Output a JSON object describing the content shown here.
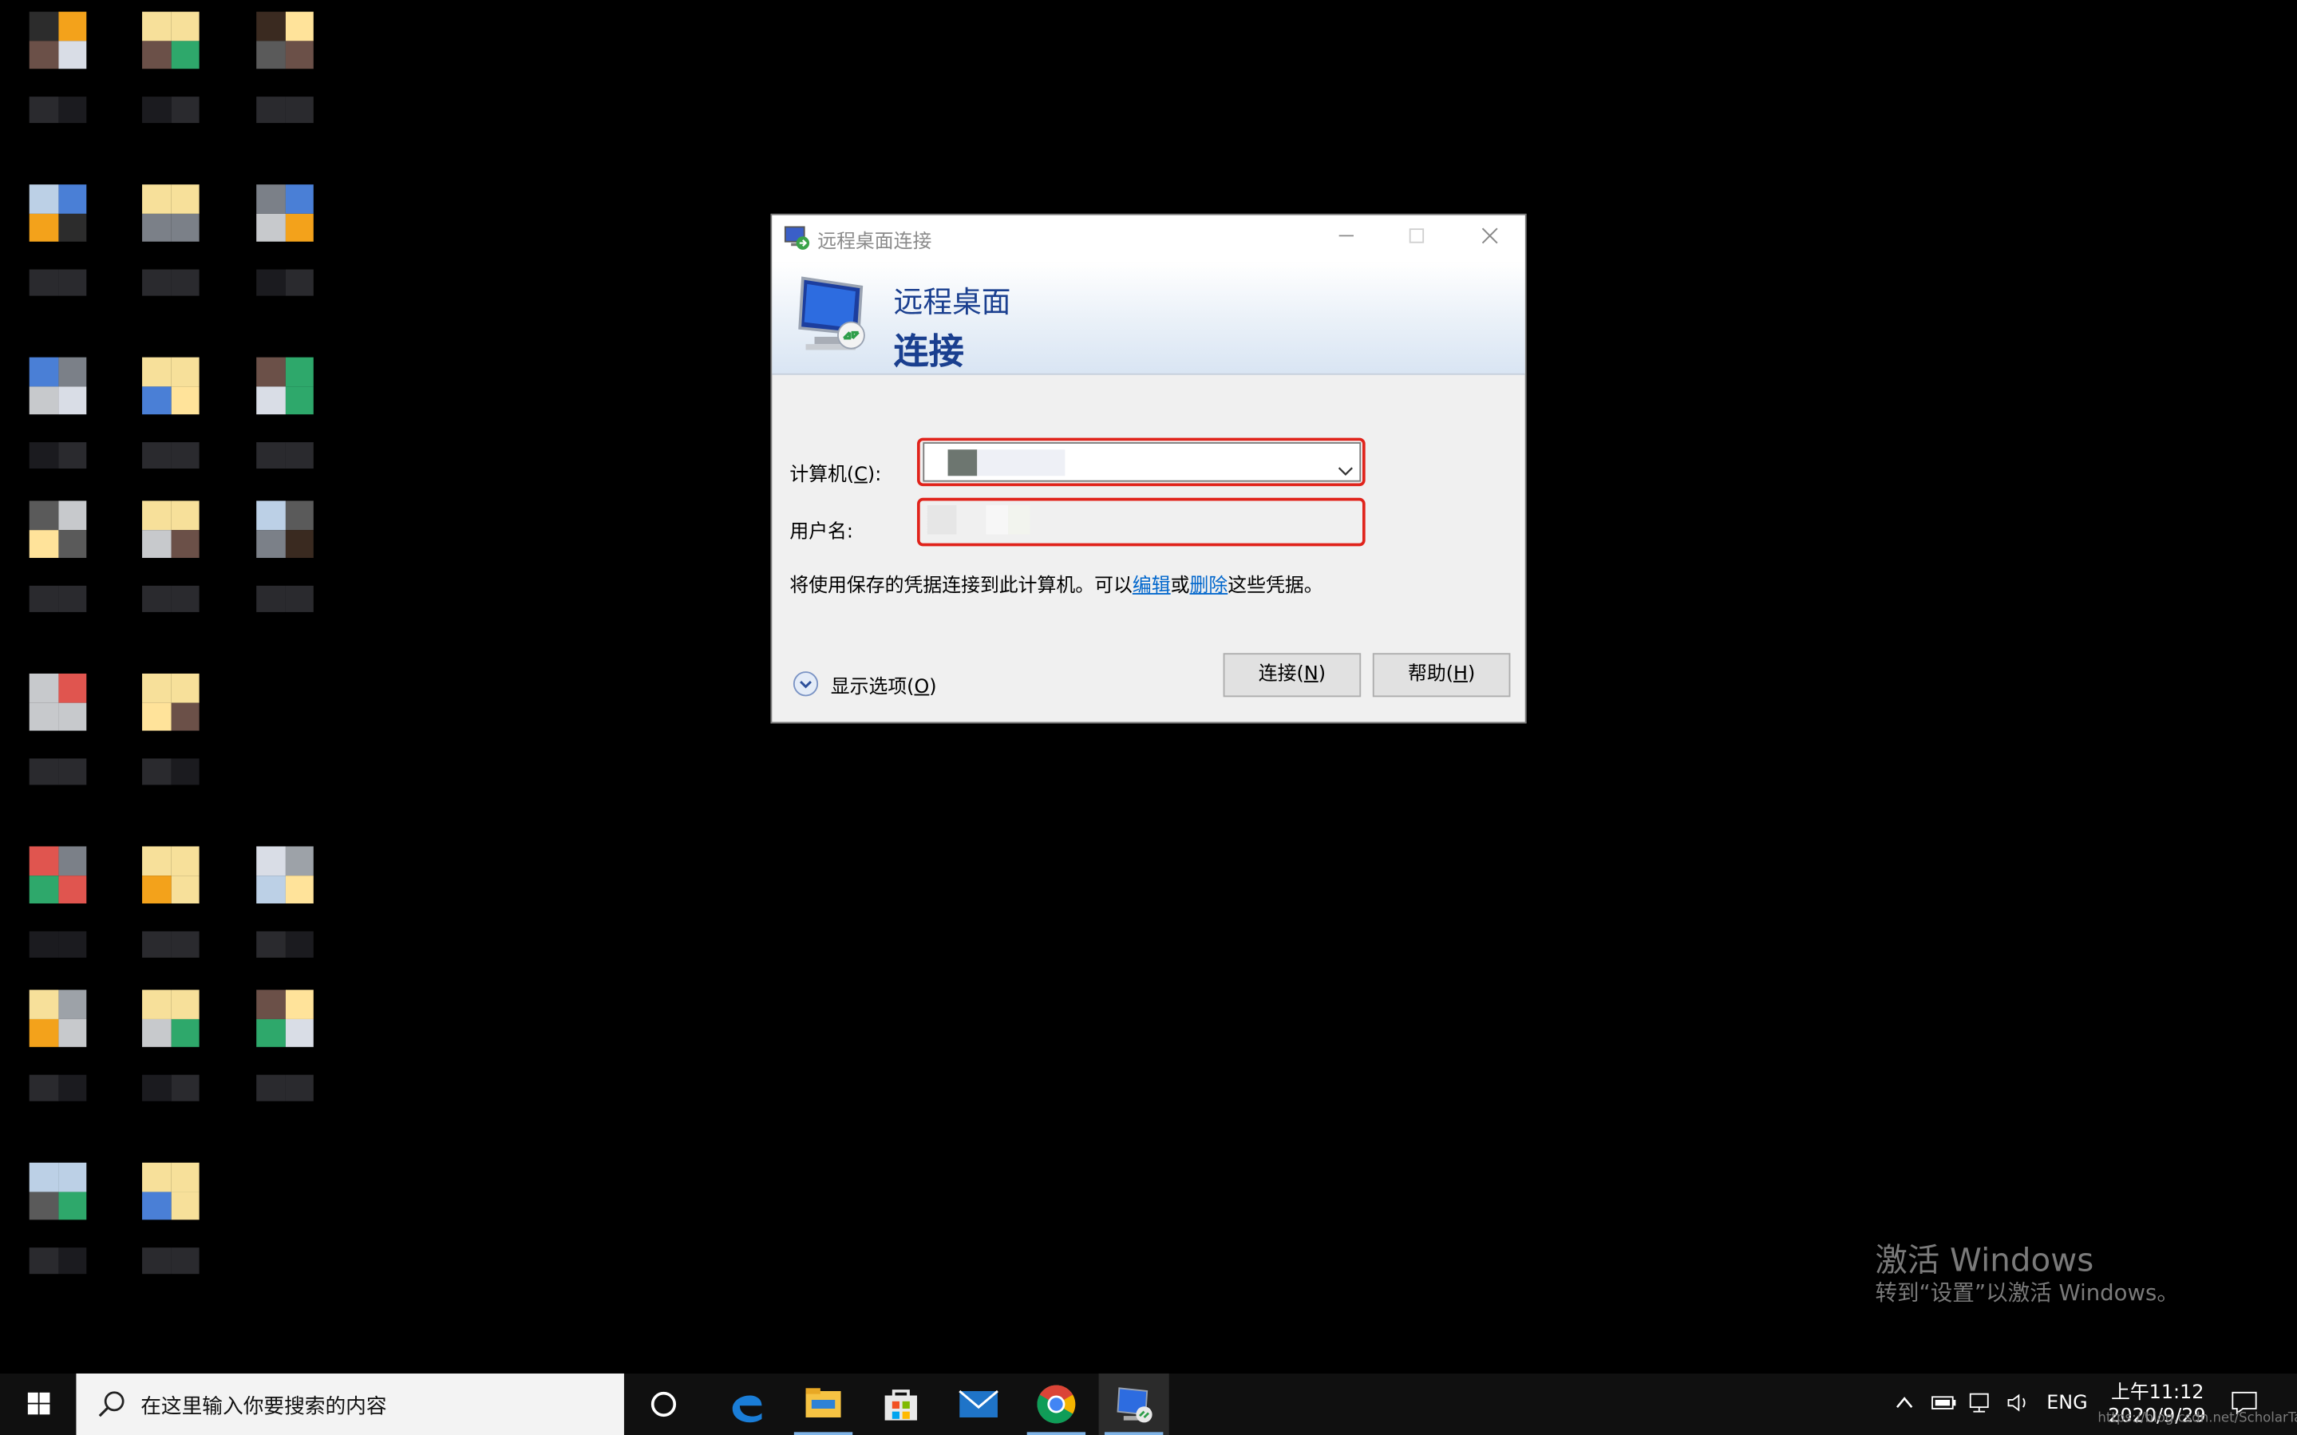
{
  "dialog": {
    "window_title": "远程桌面连接",
    "banner_line1": "远程桌面",
    "banner_line2": "连接",
    "computer_label": "计算机(",
    "computer_hotkey": "C",
    "computer_label_end": "):",
    "username_label": "用户名:",
    "info_prefix": "将使用保存的凭据连接到此计算机。可以",
    "info_edit_link": "编辑",
    "info_or": "或",
    "info_delete_link": "删除",
    "info_suffix": "这些凭据。",
    "show_options_label": "显示选项(",
    "show_options_hotkey": "O",
    "show_options_end": ")",
    "connect_button": "连接(",
    "connect_hotkey": "N",
    "connect_end": ")",
    "help_button": "帮助(",
    "help_hotkey": "H",
    "help_end": ")",
    "highlight_color": "#e0231b",
    "banner_text_color": "#1a3f8f"
  },
  "watermark": {
    "line1": "激活 Windows",
    "line2": "转到“设置”以激活 Windows。"
  },
  "taskbar": {
    "search_placeholder": "在这里输入你要搜索的内容",
    "apps": [
      "cortana-icon",
      "edge-icon",
      "file-explorer-icon",
      "store-icon",
      "mail-icon",
      "chrome-icon",
      "remote-desktop-icon"
    ],
    "language": "ENG",
    "time": "上午11:12",
    "date": "2020/9/29",
    "credit": "https://blog.csdn.net/ScholarTang"
  }
}
